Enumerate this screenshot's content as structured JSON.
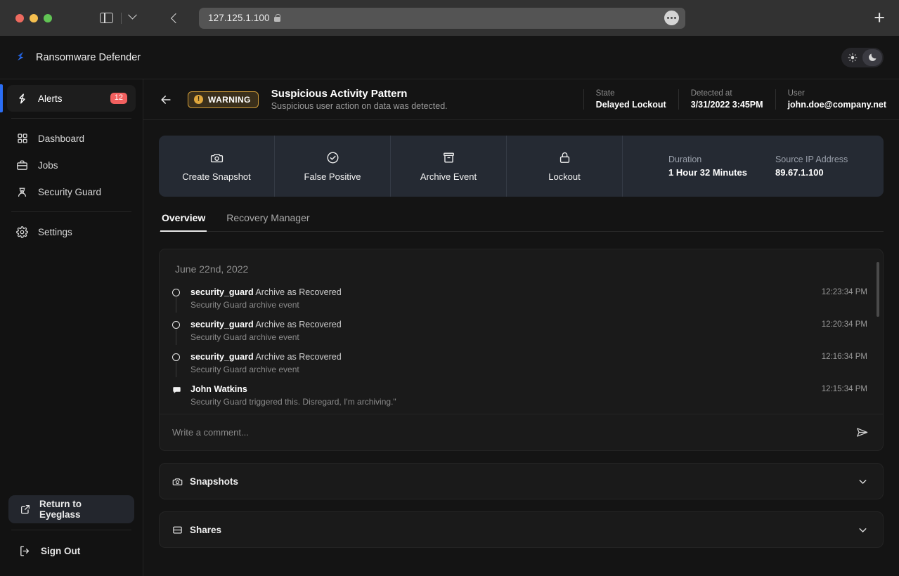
{
  "browser": {
    "url": "127.125.1.100",
    "lock_icon": "lock-icon",
    "sidebar_toggle_icon": "sidebar-toggle-icon",
    "dropdown_icon": "chevron-down-icon",
    "back_icon": "chevron-left-icon",
    "page_menu_icon": "ellipsis-icon",
    "new_tab_label": "+"
  },
  "topbar": {
    "brand": "Ransomware Defender",
    "logo_icon": "bolt-logo-icon",
    "theme": {
      "light_icon": "sun-icon",
      "dark_icon": "moon-icon",
      "selected": "dark"
    }
  },
  "sidebar": {
    "items": [
      {
        "label": "Alerts",
        "icon": "bolt-icon",
        "badge": "12",
        "active": true
      },
      {
        "label": "Dashboard",
        "icon": "grid-icon",
        "badge": "",
        "active": false
      },
      {
        "label": "Jobs",
        "icon": "briefcase-icon",
        "badge": "",
        "active": false
      },
      {
        "label": "Security Guard",
        "icon": "guard-icon",
        "badge": "",
        "active": false
      },
      {
        "label": "Settings",
        "icon": "gear-icon",
        "badge": "",
        "active": false
      }
    ],
    "return_button": {
      "label": "Return to Eyeglass",
      "icon": "external-link-icon"
    },
    "sign_out": {
      "label": "Sign Out",
      "icon": "logout-icon"
    }
  },
  "alert_header": {
    "back_icon": "arrow-left-icon",
    "severity": "WARNING",
    "severity_icon": "warning-circle-icon",
    "severity_color": "#cf9b38",
    "title": "Suspicious Activity Pattern",
    "subtitle": "Suspicious user action on data was detected.",
    "meta": [
      {
        "label": "State",
        "value": "Delayed Lockout"
      },
      {
        "label": "Detected at",
        "value": "3/31/2022 3:45PM"
      },
      {
        "label": "User",
        "value": "john.doe@company.net"
      }
    ]
  },
  "actions": {
    "buttons": [
      {
        "label": "Create Snapshot",
        "icon": "camera-icon"
      },
      {
        "label": "False Positive",
        "icon": "check-circle-icon"
      },
      {
        "label": "Archive Event",
        "icon": "archive-icon"
      },
      {
        "label": "Lockout",
        "icon": "lock-icon"
      }
    ],
    "info": [
      {
        "label": "Duration",
        "value": "1 Hour 32 Minutes"
      },
      {
        "label": "Source IP Address",
        "value": "89.67.1.100"
      }
    ]
  },
  "tabs": [
    {
      "label": "Overview",
      "active": true
    },
    {
      "label": "Recovery Manager",
      "active": false
    }
  ],
  "feed": {
    "date": "June 22nd, 2022",
    "entries": [
      {
        "icon": "circle-icon",
        "actor": "security_guard",
        "action": "Archive as Recovered",
        "detail": "Security Guard archive event",
        "time": "12:23:34 PM"
      },
      {
        "icon": "circle-icon",
        "actor": "security_guard",
        "action": "Archive as Recovered",
        "detail": "Security Guard archive event",
        "time": "12:20:34 PM"
      },
      {
        "icon": "circle-icon",
        "actor": "security_guard",
        "action": "Archive as Recovered",
        "detail": "Security Guard archive event",
        "time": "12:16:34 PM"
      },
      {
        "icon": "comment-icon",
        "actor": "John Watkins",
        "action": "",
        "detail": "Security Guard triggered this. Disregard, I'm archiving.\"",
        "time": "12:15:34 PM"
      }
    ],
    "comment_placeholder": "Write a comment...",
    "send_icon": "send-icon"
  },
  "sections": [
    {
      "label": "Snapshots",
      "icon": "camera-icon",
      "expander_icon": "chevron-down-icon"
    },
    {
      "label": "Shares",
      "icon": "server-icon",
      "expander_icon": "chevron-down-icon"
    }
  ]
}
